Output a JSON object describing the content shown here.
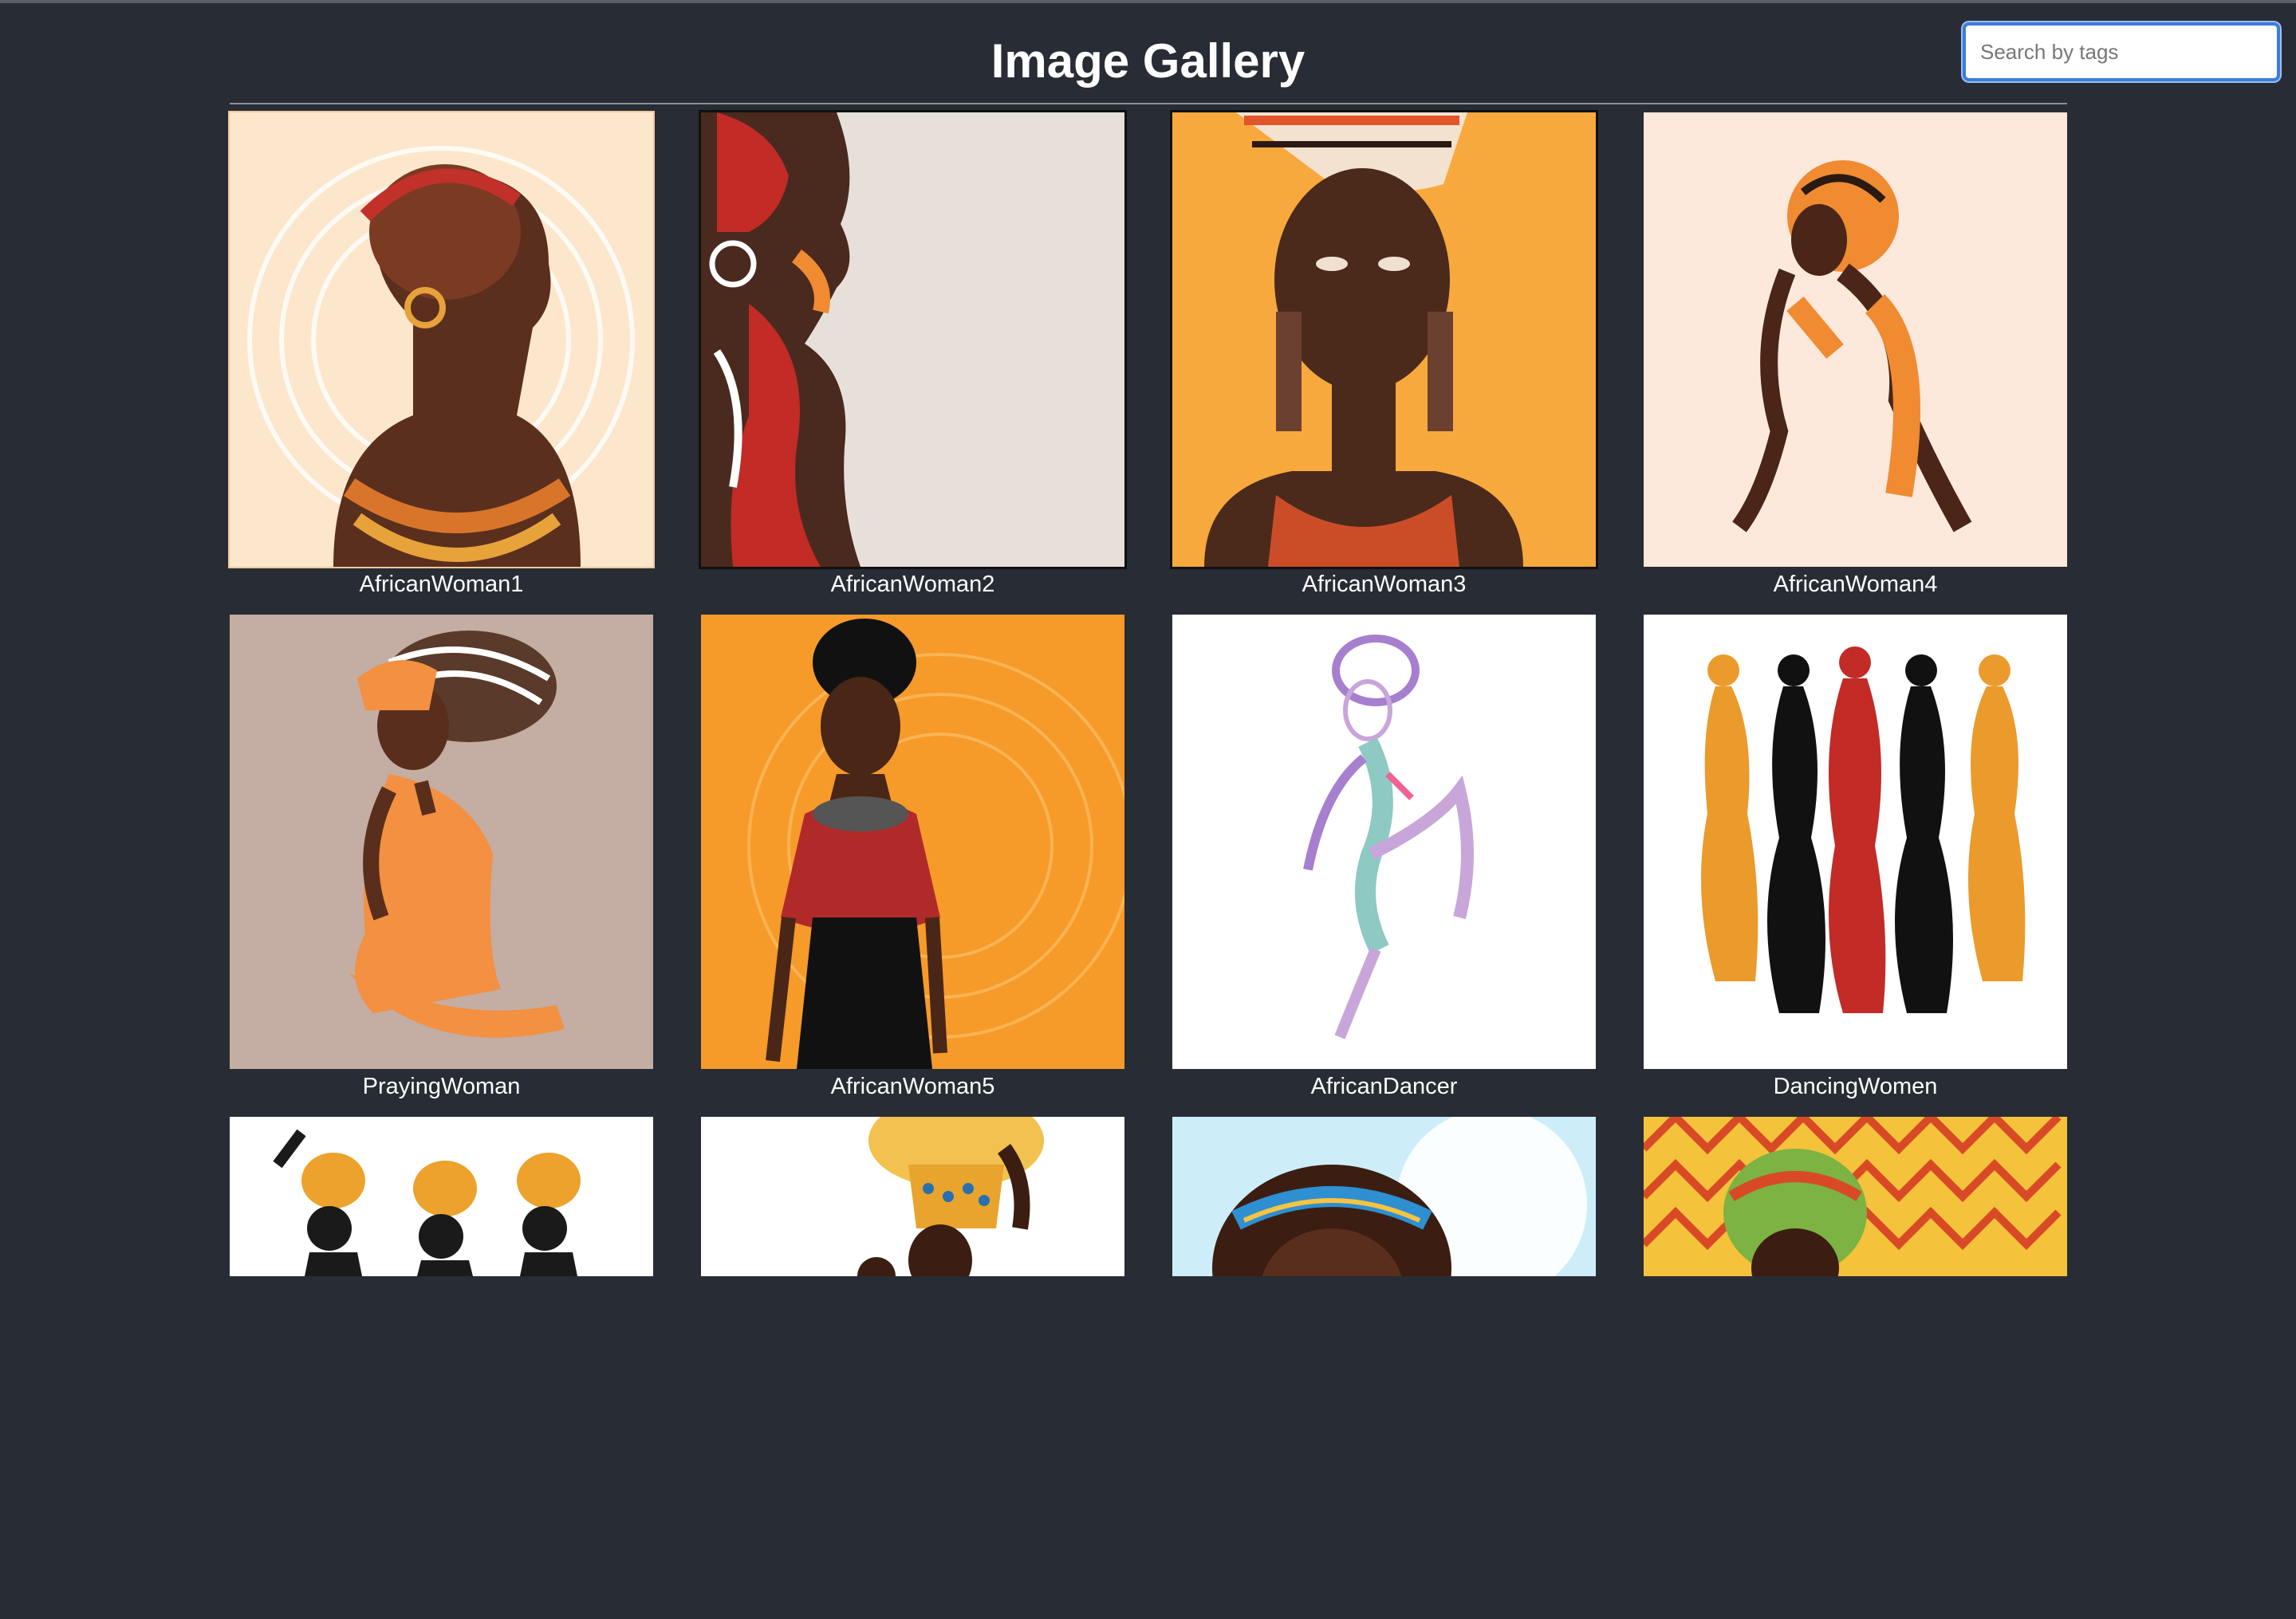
{
  "header": {
    "title": "Image Gallery",
    "search_placeholder": "Search by tags"
  },
  "gallery": {
    "items": [
      {
        "caption": "AfricanWoman1",
        "bg": "#fde7cc",
        "accent": "#d9752a",
        "skin": "#5a2f1e",
        "icon": "african-woman-profile-illustration"
      },
      {
        "caption": "AfricanWoman2",
        "bg": "#e7e0da",
        "accent": "#c22b26",
        "skin": "#4a2a1e",
        "icon": "african-woman-side-face-illustration"
      },
      {
        "caption": "AfricanWoman3",
        "bg": "#f8a93d",
        "accent": "#e2542a",
        "skin": "#4b2a1b",
        "icon": "african-woman-headdress-illustration"
      },
      {
        "caption": "AfricanWoman4",
        "bg": "#fde8dc",
        "accent": "#f08b32",
        "skin": "#4a2518",
        "icon": "african-woman-seated-illustration"
      },
      {
        "caption": "PrayingWoman",
        "bg": "#c4ada2",
        "accent": "#f39041",
        "skin": "#5a2e1c",
        "icon": "praying-woman-illustration"
      },
      {
        "caption": "AfricanWoman5",
        "bg": "#f69a2a",
        "accent": "#b12a2a",
        "skin": "#4a2616",
        "icon": "african-woman-red-top-illustration"
      },
      {
        "caption": "AfricanDancer",
        "bg": "#ffffff",
        "accent": "#a77fcf",
        "skin": "#c8a6d9",
        "icon": "african-dancer-illustration"
      },
      {
        "caption": "DancingWomen",
        "bg": "#ffffff",
        "accent": "#eb9a2c",
        "skin": "#111111",
        "icon": "dancing-women-silhouettes-illustration"
      }
    ],
    "partial_row": [
      {
        "bg": "#ffffff",
        "accent": "#eca22c",
        "skin": "#1a1a1a",
        "icon": "women-silhouettes-headwraps-illustration"
      },
      {
        "bg": "#ffffff",
        "accent": "#e8a42c",
        "skin": "#3b1d12",
        "icon": "woman-carrying-basket-illustration"
      },
      {
        "bg": "#cdeef9",
        "accent": "#2e8fd1",
        "skin": "#3b1d12",
        "icon": "woman-afro-headband-illustration"
      },
      {
        "bg": "#f4c23b",
        "accent": "#d84a26",
        "skin": "#3b1d12",
        "icon": "woman-patterned-background-illustration"
      }
    ]
  }
}
